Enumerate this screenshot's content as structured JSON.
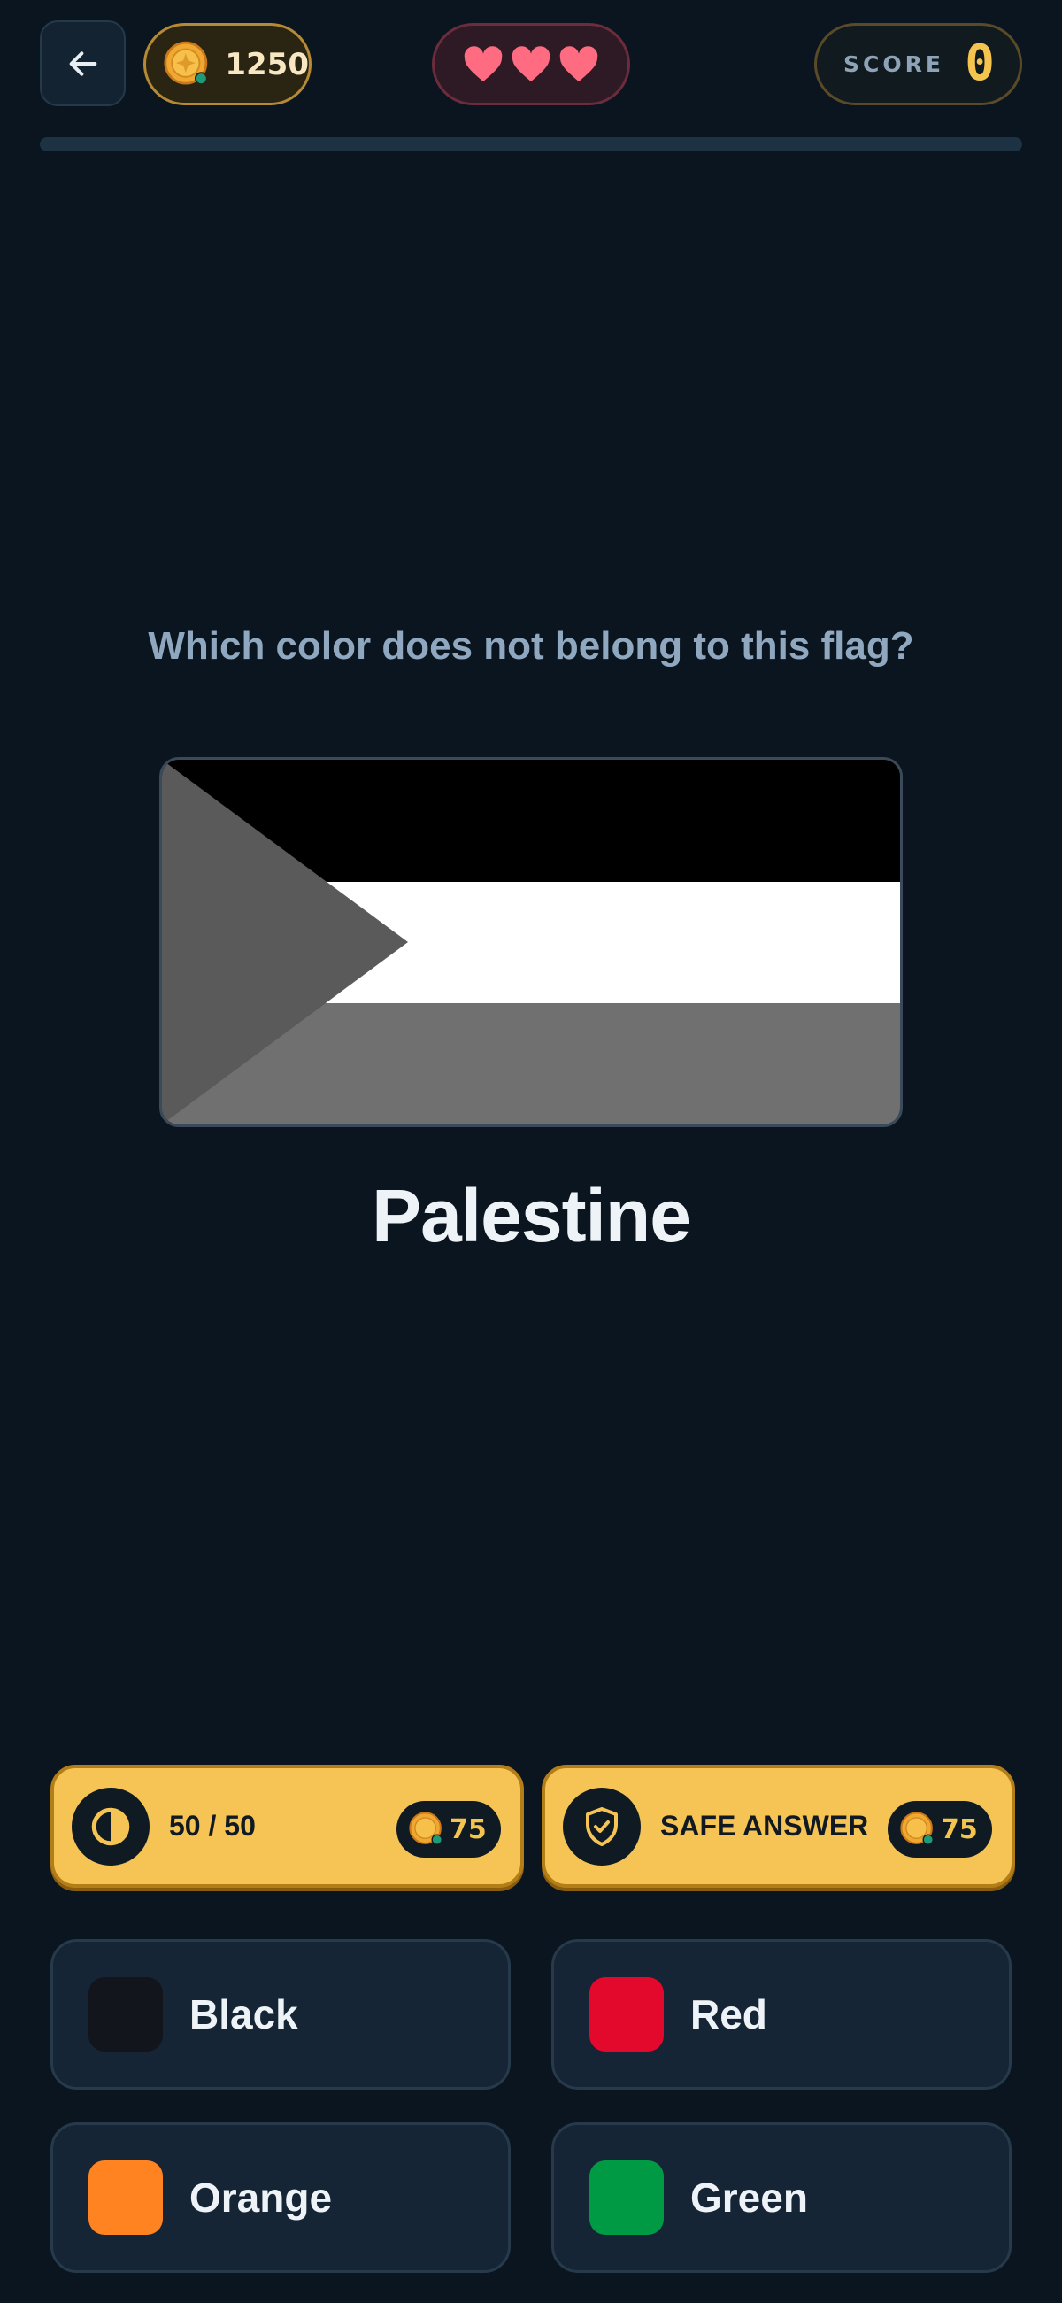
{
  "header": {
    "coins": "1250",
    "lives": 3,
    "score_label": "SCORE",
    "score_value": "0",
    "progress": 0.0
  },
  "question": {
    "prompt": "Which color does not belong to this flag?",
    "country": "Palestine",
    "flag_colors": {
      "top": "#000000",
      "middle": "#ffffff",
      "bottom": "#707070",
      "triangle": "#5a5a5a"
    }
  },
  "powerups": [
    {
      "label": "50 / 50",
      "cost": "75",
      "icon": "half-circle-icon"
    },
    {
      "label": "SAFE ANSWER",
      "cost": "75",
      "icon": "shield-check-icon"
    }
  ],
  "answers": [
    {
      "label": "Black",
      "color": "#12151b"
    },
    {
      "label": "Red",
      "color": "#e2092c"
    },
    {
      "label": "Orange",
      "color": "#ff8421"
    },
    {
      "label": "Green",
      "color": "#009a44"
    }
  ],
  "colors": {
    "background": "#0a1520",
    "accent": "#f5c44f",
    "heart": "#ff6b81"
  }
}
